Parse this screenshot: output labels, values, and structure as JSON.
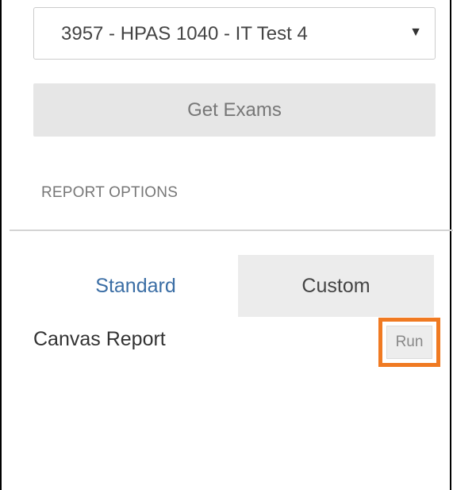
{
  "exam_select": {
    "selected_value": "3957 - HPAS 1040 - IT Test 4",
    "caret_icon": "triangle-down-icon"
  },
  "get_exams_button": {
    "label": "Get Exams"
  },
  "report_options": {
    "section_label": "REPORT OPTIONS",
    "tabs": [
      {
        "label": "Standard"
      },
      {
        "label": "Custom"
      }
    ],
    "reports": [
      {
        "name": "Canvas Report",
        "action_label": "Run"
      }
    ]
  },
  "colors": {
    "highlight": "#f07a22",
    "active_tab_text": "#3b6ea5"
  }
}
